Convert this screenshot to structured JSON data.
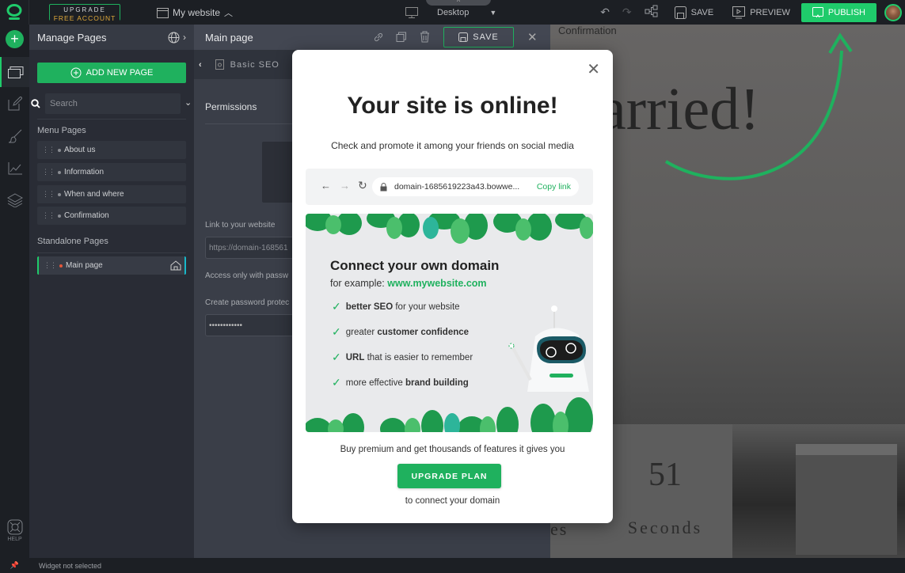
{
  "topbar": {
    "upgrade_line1": "UPGRADE",
    "upgrade_line2": "FREE ACCOUNT",
    "site_name": "My website",
    "device": "Desktop",
    "save": "SAVE",
    "preview": "PREVIEW",
    "publish": "PUBLISH"
  },
  "rail": {
    "help": "HELP"
  },
  "pages_panel": {
    "title": "Manage Pages",
    "add_page": "ADD NEW PAGE",
    "search_placeholder": "Search",
    "menu_section": "Menu Pages",
    "menu_pages": [
      {
        "label": "About us"
      },
      {
        "label": "Information"
      },
      {
        "label": "When and where"
      },
      {
        "label": "Confirmation"
      }
    ],
    "standalone_section": "Standalone Pages",
    "standalone_pages": [
      {
        "label": "Main page",
        "home": true,
        "active": true
      }
    ]
  },
  "settings_panel": {
    "title": "Main page",
    "save": "SAVE",
    "subsection": "Basic SEO",
    "permissions": "Permissions",
    "link_label": "Link to your website",
    "link_value": "https://domain-168561",
    "access_label": "Access only with passw",
    "password_label": "Create password protec",
    "password_value": "••••••••••••"
  },
  "preview": {
    "page_label": "Confirmation",
    "headline": "arried!",
    "count_value": "51",
    "count_unit": "Seconds",
    "prev_unit_fragment": "es"
  },
  "statusbar": {
    "text": "Widget not selected"
  },
  "modal": {
    "title": "Your site is online!",
    "subtitle": "Check and promote it among your friends on social media",
    "url": "domain-1685619223a43.bowwe...",
    "copy_link": "Copy link",
    "promo_title": "Connect your own domain",
    "promo_example_prefix": "for example: ",
    "promo_example_link": "www.mywebsite.com",
    "benefits": [
      {
        "bold": "better SEO",
        "rest_after": " for your website",
        "rest_before": ""
      },
      {
        "bold": "customer confidence",
        "rest_after": "",
        "rest_before": "greater "
      },
      {
        "bold": "URL",
        "rest_after": " that is easier to remember",
        "rest_before": ""
      },
      {
        "bold": "brand building",
        "rest_after": "",
        "rest_before": "more effective "
      }
    ],
    "buy_text": "Buy premium and get thousands of features it gives you",
    "upgrade_button": "UPGRADE PLAN",
    "connect_text": "to connect your domain"
  },
  "colors": {
    "accent": "#1fcb6b",
    "accent_dark": "#1fb15e",
    "upgrade_gold": "#e0a93a",
    "home_marker": "#18b8c9",
    "active_dot": "#e4563a"
  }
}
